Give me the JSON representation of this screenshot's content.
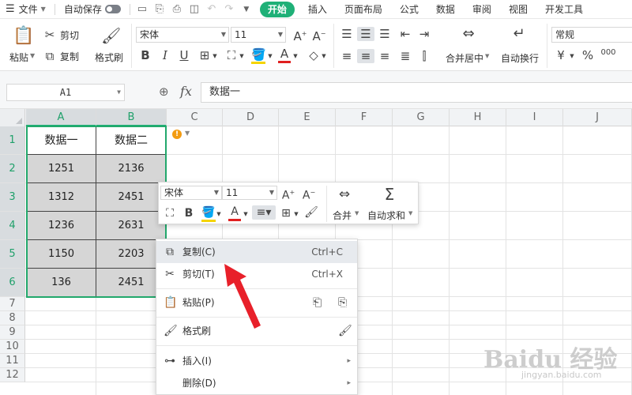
{
  "menubar": {
    "file_label": "文件",
    "autosave_label": "自动保存",
    "tabs": [
      "开始",
      "插入",
      "页面布局",
      "公式",
      "数据",
      "审阅",
      "视图",
      "开发工具"
    ]
  },
  "ribbon": {
    "paste": "粘贴",
    "cut": "剪切",
    "copy": "复制",
    "format_painter": "格式刷",
    "font_name": "宋体",
    "font_size": "11",
    "merge_center": "合并居中",
    "wrap_text": "自动换行",
    "number_format": "常规",
    "bold": "B",
    "italic": "I",
    "underline": "U",
    "font_color_glyph": "A",
    "percent": "%",
    "currency": "¥",
    "thousands": "000"
  },
  "formula_bar": {
    "name_box": "A1",
    "fx": "fx",
    "content": "数据一"
  },
  "grid": {
    "columns": [
      "A",
      "B",
      "C",
      "D",
      "E",
      "F",
      "G",
      "H",
      "I",
      "J"
    ],
    "rows": [
      "1",
      "2",
      "3",
      "4",
      "5",
      "6",
      "7",
      "8",
      "9",
      "10",
      "11",
      "12"
    ],
    "header": [
      "数据一",
      "数据二"
    ],
    "data": [
      [
        "1251",
        "2136"
      ],
      [
        "1312",
        "2451"
      ],
      [
        "1236",
        "2631"
      ],
      [
        "1150",
        "2203"
      ],
      [
        "136",
        "2451"
      ]
    ]
  },
  "mini_toolbar": {
    "font_name": "宋体",
    "font_size": "11",
    "merge": "合并",
    "autosum": "自动求和",
    "bold": "B"
  },
  "context_menu": {
    "items": [
      {
        "label": "复制(C)",
        "shortcut": "Ctrl+C"
      },
      {
        "label": "剪切(T)",
        "shortcut": "Ctrl+X"
      },
      {
        "label": "粘贴(P)",
        "shortcut": ""
      },
      {
        "label": "格式刷",
        "shortcut": ""
      },
      {
        "label": "插入(I)",
        "shortcut": ""
      },
      {
        "label": "删除(D)",
        "shortcut": ""
      }
    ]
  },
  "watermark": {
    "brand": "Baidu 经验",
    "url": "jingyan.baidu.com"
  },
  "colors": {
    "accent": "#1fb077",
    "selection": "#22a86c",
    "arrow": "#e8202a"
  }
}
